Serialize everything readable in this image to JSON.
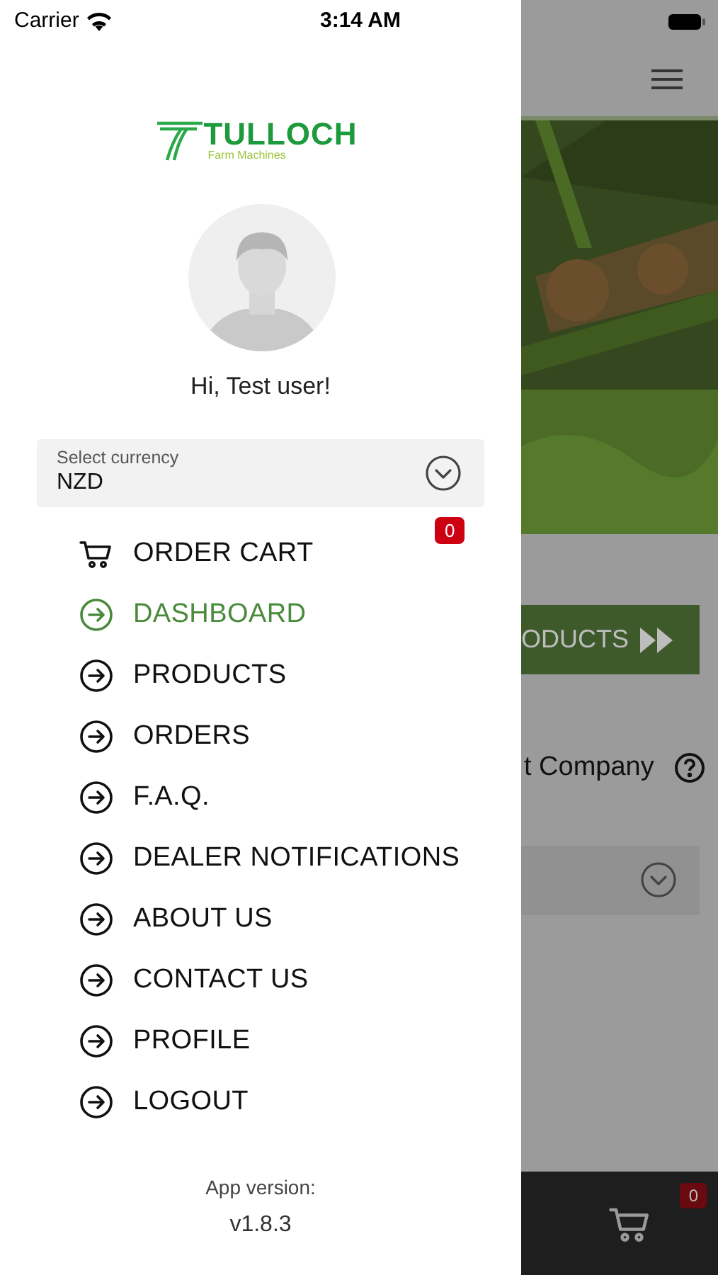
{
  "status_bar": {
    "carrier": "Carrier",
    "time": "3:14 AM"
  },
  "drawer": {
    "logo": {
      "name": "TULLOCH",
      "tagline": "Farm Machines"
    },
    "greeting": "Hi, Test user!",
    "currency": {
      "label": "Select currency",
      "value": "NZD"
    },
    "menu": [
      {
        "label": "ORDER CART",
        "kind": "cart",
        "selected": false,
        "badge": "0"
      },
      {
        "label": "DASHBOARD",
        "kind": "link",
        "selected": true
      },
      {
        "label": "PRODUCTS",
        "kind": "link",
        "selected": false
      },
      {
        "label": "ORDERS",
        "kind": "link",
        "selected": false
      },
      {
        "label": "F.A.Q.",
        "kind": "link",
        "selected": false
      },
      {
        "label": "DEALER NOTIFICATIONS",
        "kind": "link",
        "selected": false
      },
      {
        "label": "ABOUT US",
        "kind": "link",
        "selected": false
      },
      {
        "label": "CONTACT US",
        "kind": "link",
        "selected": false
      },
      {
        "label": "PROFILE",
        "kind": "link",
        "selected": false
      },
      {
        "label": "LOGOUT",
        "kind": "link",
        "selected": false
      }
    ],
    "version_label": "App version:",
    "version": "v1.8.3"
  },
  "background": {
    "button_label": "ODUCTS",
    "company_text": "t Company",
    "cart_badge": "0"
  }
}
